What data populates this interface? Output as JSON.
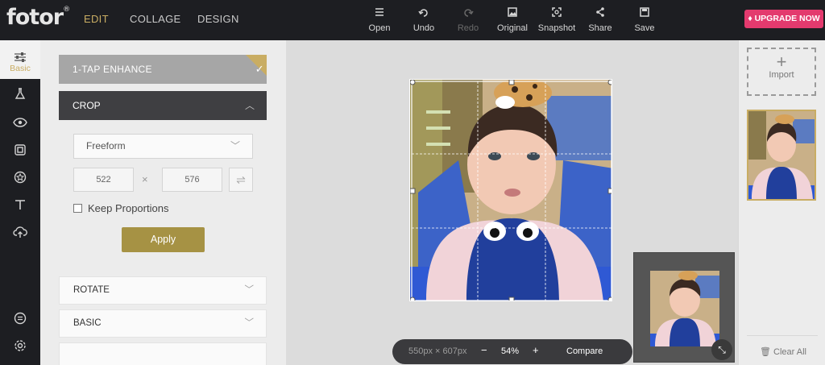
{
  "app": {
    "logo": "fotor",
    "logo_mark": "®",
    "nav_tabs": [
      {
        "label": "EDIT",
        "active": true
      },
      {
        "label": "COLLAGE",
        "active": false
      },
      {
        "label": "DESIGN",
        "active": false
      }
    ],
    "upgrade_label": "UPGRADE NOW"
  },
  "toolbar": [
    {
      "label": "Open",
      "icon": "menu-icon"
    },
    {
      "label": "Undo",
      "icon": "undo-icon"
    },
    {
      "label": "Redo",
      "icon": "redo-icon",
      "disabled": true
    },
    {
      "label": "Original",
      "icon": "image-icon"
    },
    {
      "label": "Snapshot",
      "icon": "snapshot-icon"
    },
    {
      "label": "Share",
      "icon": "share-icon"
    },
    {
      "label": "Save",
      "icon": "save-icon"
    }
  ],
  "sidebar": {
    "items": [
      {
        "label": "Basic",
        "icon": "sliders-icon",
        "active": true
      },
      {
        "icon": "flask-icon"
      },
      {
        "icon": "eye-icon"
      },
      {
        "icon": "frame-icon"
      },
      {
        "icon": "sticker-icon"
      },
      {
        "icon": "text-icon"
      },
      {
        "icon": "cloud-upload-icon"
      },
      {
        "icon": "settings-circle-icon"
      },
      {
        "icon": "gear-icon"
      }
    ]
  },
  "panel": {
    "enhance_label": "1-TAP ENHANCE",
    "crop_label": "CROP",
    "ratio_value": "Freeform",
    "width_value": "522",
    "height_value": "576",
    "times": "×",
    "keep_proportions_label": "Keep Proportions",
    "keep_proportions_checked": false,
    "apply_label": "Apply",
    "sections": [
      {
        "label": "ROTATE"
      },
      {
        "label": "BASIC"
      }
    ]
  },
  "canvas": {
    "dimensions": "550px × 607px",
    "zoom_minus": "−",
    "zoom_value": "54%",
    "zoom_plus": "+",
    "compare_label": "Compare"
  },
  "right_panel": {
    "import_label": "Import",
    "clear_label": "Clear All"
  },
  "colors": {
    "accent_gold": "#c9ad63",
    "upgrade_pink": "#e33a6e",
    "apply_gold": "#a69244",
    "dark_bar": "#1d1e22"
  }
}
